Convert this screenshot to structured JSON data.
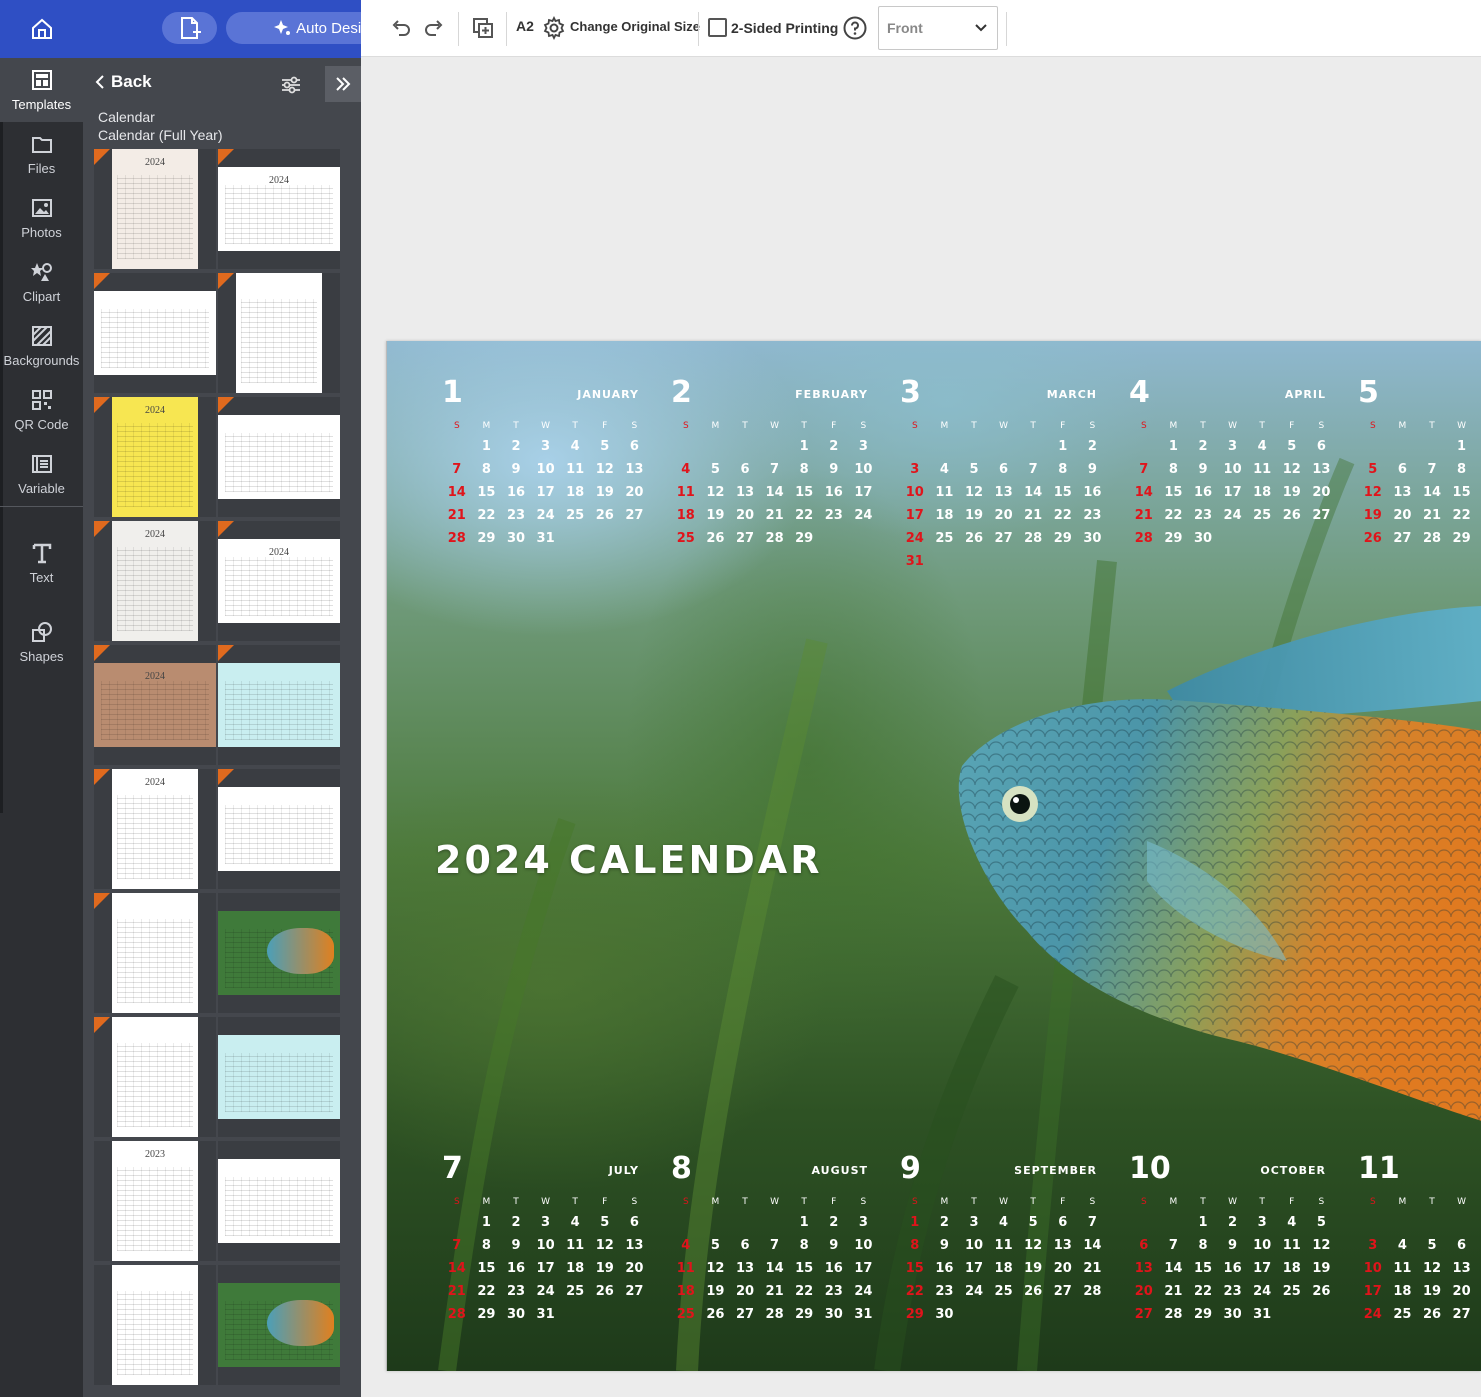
{
  "sidebar": {
    "items": [
      {
        "label": "Templates",
        "icon": "templates-icon"
      },
      {
        "label": "Files",
        "icon": "folder-icon"
      },
      {
        "label": "Photos",
        "icon": "photo-icon"
      },
      {
        "label": "Clipart",
        "icon": "clipart-icon"
      },
      {
        "label": "Backgrounds",
        "icon": "backgrounds-icon"
      },
      {
        "label": "QR Code",
        "icon": "qr-code-icon"
      },
      {
        "label": "Variable",
        "icon": "variable-icon"
      },
      {
        "label": "Text",
        "icon": "text-icon"
      },
      {
        "label": "Shapes",
        "icon": "shapes-icon"
      }
    ]
  },
  "topbar": {
    "auto_design_label": "Auto Design"
  },
  "panel": {
    "back_label": "Back",
    "crumb_category": "Calendar",
    "crumb_subcategory": "Calendar (Full Year)",
    "thumbnails": [
      {
        "title": "2024",
        "kind": "beige"
      },
      {
        "title": "2024",
        "kind": "photos"
      },
      {
        "title": "",
        "kind": "landscape-lines"
      },
      {
        "title": "",
        "kind": "portrait-plain"
      },
      {
        "title": "2024",
        "kind": "colorful"
      },
      {
        "title": "",
        "kind": "photo-grid"
      },
      {
        "title": "2024",
        "kind": "gray"
      },
      {
        "title": "2024",
        "kind": "planner"
      },
      {
        "title": "2024",
        "kind": "brown"
      },
      {
        "title": "",
        "kind": "aqua"
      },
      {
        "title": "2024",
        "kind": "cafe"
      },
      {
        "title": "",
        "kind": "horse"
      },
      {
        "title": "",
        "kind": "bridge"
      },
      {
        "title": "",
        "kind": "fish"
      },
      {
        "title": "",
        "kind": "food"
      },
      {
        "title": "",
        "kind": "aqua"
      },
      {
        "title": "2023",
        "kind": "cafe"
      },
      {
        "title": "",
        "kind": "horse"
      },
      {
        "title": "",
        "kind": "bridge"
      },
      {
        "title": "",
        "kind": "fish"
      }
    ]
  },
  "toolbar": {
    "paper_size": "A2",
    "change_size_label": "Change Original Size",
    "two_sided_label": "2-Sided Printing",
    "side_select_value": "Front"
  },
  "canvas": {
    "title": "2024 CALENDAR",
    "weekday_headers": [
      "S",
      "M",
      "T",
      "W",
      "T",
      "F",
      "S"
    ],
    "months": [
      {
        "num": "1",
        "name": "January",
        "rows": [
          [
            "",
            "1",
            "2",
            "3",
            "4",
            "5",
            "6"
          ],
          [
            "7",
            "8",
            "9",
            "10",
            "11",
            "12",
            "13"
          ],
          [
            "14",
            "15",
            "16",
            "17",
            "18",
            "19",
            "20"
          ],
          [
            "21",
            "22",
            "23",
            "24",
            "25",
            "26",
            "27"
          ],
          [
            "28",
            "29",
            "30",
            "31",
            "",
            "",
            ""
          ]
        ]
      },
      {
        "num": "2",
        "name": "February",
        "rows": [
          [
            "",
            "",
            "",
            "",
            "1",
            "2",
            "3"
          ],
          [
            "4",
            "5",
            "6",
            "7",
            "8",
            "9",
            "10"
          ],
          [
            "11",
            "12",
            "13",
            "14",
            "15",
            "16",
            "17"
          ],
          [
            "18",
            "19",
            "20",
            "21",
            "22",
            "23",
            "24"
          ],
          [
            "25",
            "26",
            "27",
            "28",
            "29",
            "",
            ""
          ]
        ]
      },
      {
        "num": "3",
        "name": "March",
        "rows": [
          [
            "",
            "",
            "",
            "",
            "",
            "1",
            "2"
          ],
          [
            "3",
            "4",
            "5",
            "6",
            "7",
            "8",
            "9"
          ],
          [
            "10",
            "11",
            "12",
            "13",
            "14",
            "15",
            "16"
          ],
          [
            "17",
            "18",
            "19",
            "20",
            "21",
            "22",
            "23"
          ],
          [
            "24",
            "25",
            "26",
            "27",
            "28",
            "29",
            "30"
          ],
          [
            "31",
            "",
            "",
            "",
            "",
            "",
            ""
          ]
        ]
      },
      {
        "num": "4",
        "name": "April",
        "rows": [
          [
            "",
            "1",
            "2",
            "3",
            "4",
            "5",
            "6"
          ],
          [
            "7",
            "8",
            "9",
            "10",
            "11",
            "12",
            "13"
          ],
          [
            "14",
            "15",
            "16",
            "17",
            "18",
            "19",
            "20"
          ],
          [
            "21",
            "22",
            "23",
            "24",
            "25",
            "26",
            "27"
          ],
          [
            "28",
            "29",
            "30",
            "",
            "",
            "",
            ""
          ]
        ]
      },
      {
        "num": "5",
        "name": "",
        "rows": [
          [
            "",
            "",
            "",
            "1",
            "",
            "",
            ""
          ],
          [
            "5",
            "6",
            "7",
            "8",
            "",
            "",
            ""
          ],
          [
            "12",
            "13",
            "14",
            "15",
            "",
            "",
            ""
          ],
          [
            "19",
            "20",
            "21",
            "22",
            "",
            "",
            ""
          ],
          [
            "26",
            "27",
            "28",
            "29",
            "",
            "",
            ""
          ]
        ]
      },
      {
        "num": "7",
        "name": "July",
        "rows": [
          [
            "",
            "1",
            "2",
            "3",
            "4",
            "5",
            "6"
          ],
          [
            "7",
            "8",
            "9",
            "10",
            "11",
            "12",
            "13"
          ],
          [
            "14",
            "15",
            "16",
            "17",
            "18",
            "19",
            "20"
          ],
          [
            "21",
            "22",
            "23",
            "24",
            "25",
            "26",
            "27"
          ],
          [
            "28",
            "29",
            "30",
            "31",
            "",
            "",
            ""
          ]
        ]
      },
      {
        "num": "8",
        "name": "August",
        "rows": [
          [
            "",
            "",
            "",
            "",
            "1",
            "2",
            "3"
          ],
          [
            "4",
            "5",
            "6",
            "7",
            "8",
            "9",
            "10"
          ],
          [
            "11",
            "12",
            "13",
            "14",
            "15",
            "16",
            "17"
          ],
          [
            "18",
            "19",
            "20",
            "21",
            "22",
            "23",
            "24"
          ],
          [
            "25",
            "26",
            "27",
            "28",
            "29",
            "30",
            "31"
          ]
        ]
      },
      {
        "num": "9",
        "name": "September",
        "rows": [
          [
            "1",
            "2",
            "3",
            "4",
            "5",
            "6",
            "7"
          ],
          [
            "8",
            "9",
            "10",
            "11",
            "12",
            "13",
            "14"
          ],
          [
            "15",
            "16",
            "17",
            "18",
            "19",
            "20",
            "21"
          ],
          [
            "22",
            "23",
            "24",
            "25",
            "26",
            "27",
            "28"
          ],
          [
            "29",
            "30",
            "",
            "",
            "",
            "",
            ""
          ]
        ]
      },
      {
        "num": "10",
        "name": "October",
        "rows": [
          [
            "",
            "",
            "1",
            "2",
            "3",
            "4",
            "5"
          ],
          [
            "6",
            "7",
            "8",
            "9",
            "10",
            "11",
            "12"
          ],
          [
            "13",
            "14",
            "15",
            "16",
            "17",
            "18",
            "19"
          ],
          [
            "20",
            "21",
            "22",
            "23",
            "24",
            "25",
            "26"
          ],
          [
            "27",
            "28",
            "29",
            "30",
            "31",
            "",
            ""
          ]
        ]
      },
      {
        "num": "11",
        "name": "",
        "rows": [
          [
            "",
            "",
            "",
            ""
          ],
          [
            "3",
            "4",
            "5",
            "6"
          ],
          [
            "10",
            "11",
            "12",
            "13"
          ],
          [
            "17",
            "18",
            "19",
            "20"
          ],
          [
            "24",
            "25",
            "26",
            "27"
          ]
        ]
      }
    ]
  },
  "colors": {
    "brand_blue": "#2f4fc4",
    "rail_bg": "#2d2f33",
    "panel_bg": "#44474d",
    "sunday_red": "#e0141b",
    "new_ribbon": "#e06a1e"
  }
}
